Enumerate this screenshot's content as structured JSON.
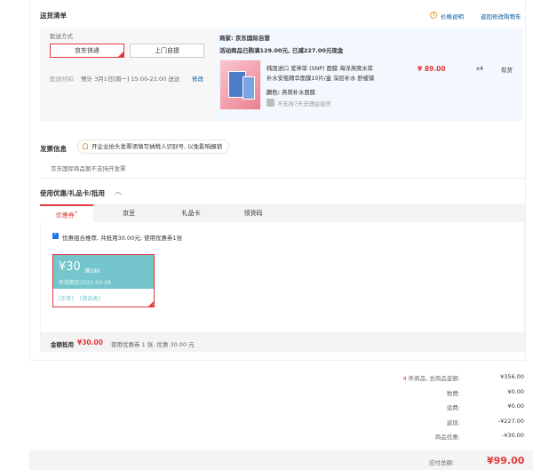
{
  "delivery": {
    "title": "送货清单",
    "price_note": "价格说明",
    "back_link": "返回修改购物车",
    "method_label": "配送方式",
    "options": [
      "京东快递",
      "上门自提"
    ],
    "time_label": "配送时间:",
    "time_value": "预计 3月1日[周一] 15:00-21:00 送达",
    "time_edit": "修改"
  },
  "shop": {
    "seller": "商家: 京东国际自营",
    "promo": "活动商品已购满129.00元, 已减227.00元现金",
    "product_name_1": "韩国进口 爱神菲 (SNP) 面膜 海洋燕窝水库",
    "product_name_2": "补水安瓶精华面膜10片/盒 深层补水 舒缓镇",
    "price": "¥ 89.00",
    "qty": "x4",
    "stock": "有货",
    "color_label": "颜色:",
    "color_value": "燕窝补水面膜",
    "return_policy": "不支持7天无理由退货"
  },
  "invoice": {
    "title": "发票信息",
    "tip": "开企业抬头发票须填写纳税人识别号, 以免影响报销",
    "note": "京东国际商品暂不支持开发票"
  },
  "coupons": {
    "title": "使用优惠/礼品卡/抵用",
    "tabs": [
      "优惠券",
      "京豆",
      "礼品卡",
      "领货码"
    ],
    "recommend": "优惠组合推荐, 共抵用30.00元; 使用优惠券1张",
    "coupon": {
      "amount": "¥30",
      "condition": "满299",
      "expiry": "有效期至2021-02-28",
      "tags": [
        "[东券]",
        "[限品类]"
      ]
    },
    "summary_label": "金额抵用",
    "summary_amount": "¥30.00",
    "summary_detail": "使用优惠券 1 张, 优惠 30.00 元"
  },
  "totals": {
    "rows": [
      {
        "label_count": "4",
        "label": "件商品, 总商品金额:",
        "value": "¥356.00"
      },
      {
        "label": "税费:",
        "value": "¥0.00"
      },
      {
        "label": "运费:",
        "value": "¥0.00"
      },
      {
        "label": "返现:",
        "value": "-¥227.00"
      },
      {
        "label": "商品优惠:",
        "value": "-¥30.00"
      }
    ],
    "payable_label": "应付总额:",
    "payable_value": "¥99.00"
  }
}
